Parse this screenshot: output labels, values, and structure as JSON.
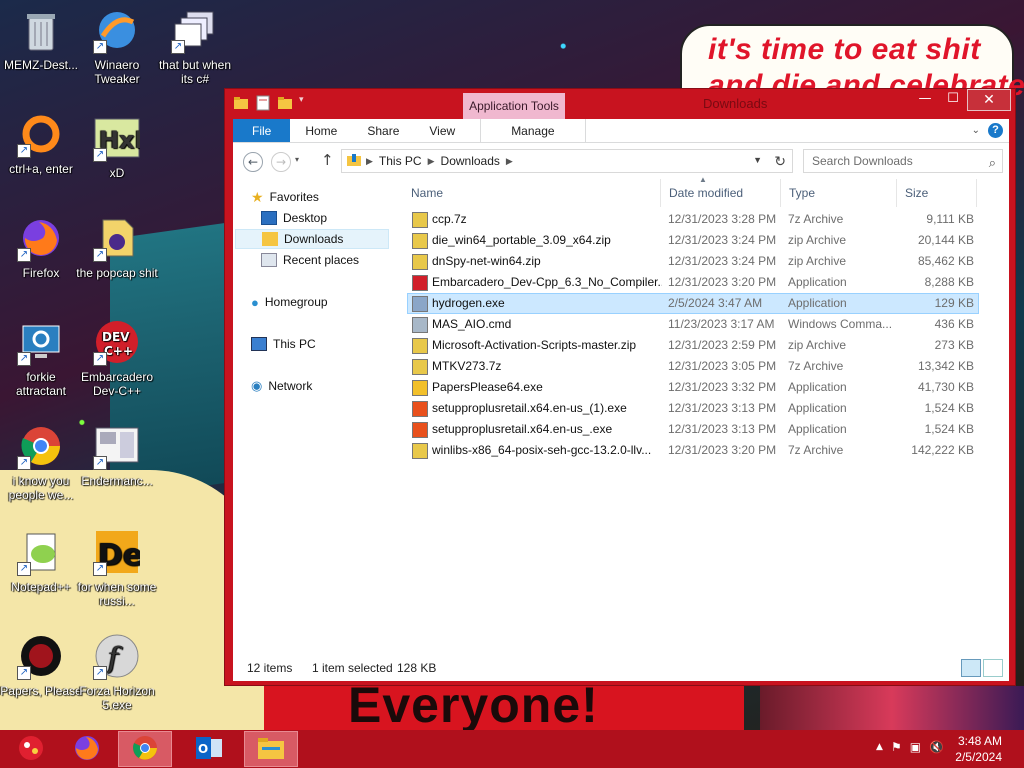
{
  "wallpaper": {
    "bubble_text": "it's time to eat shit and die and celebrate",
    "banner_text": "Everyone!"
  },
  "desktop": {
    "icons": [
      {
        "label": "MEMZ-Dest...",
        "icon": "recycle-bin-icon"
      },
      {
        "label": "Winaero Tweaker",
        "icon": "winaero-icon"
      },
      {
        "label": "that but when its c#",
        "icon": "windows-stack-icon"
      },
      {
        "label": "ctrl+a, enter",
        "icon": "orange-ring-icon"
      },
      {
        "label": "xD",
        "icon": "hxd-icon"
      },
      {
        "label": "Firefox",
        "icon": "firefox-icon"
      },
      {
        "label": "the popcap shit",
        "icon": "popcap-icon"
      },
      {
        "label": "forkie attractant",
        "icon": "gear-monitor-icon"
      },
      {
        "label": "Embarcadero Dev-C++",
        "icon": "devcpp-icon"
      },
      {
        "label": "i know you people we...",
        "icon": "chrome-icon"
      },
      {
        "label": "Endermanc...",
        "icon": "enderman-icon"
      },
      {
        "label": "Notepad++",
        "icon": "notepadpp-icon"
      },
      {
        "label": "for when some russi...",
        "icon": "de-icon"
      },
      {
        "label": "Papers, Please",
        "icon": "papers-please-icon"
      },
      {
        "label": "Forza Horizon 5.exe",
        "icon": "flash-icon"
      }
    ]
  },
  "window": {
    "title": "Downloads",
    "contextual_tab": "Application Tools",
    "ribbon_tabs": [
      "File",
      "Home",
      "Share",
      "View",
      "Manage"
    ],
    "breadcrumb": [
      "This PC",
      "Downloads"
    ],
    "search_placeholder": "Search Downloads",
    "nav": {
      "favorites": "Favorites",
      "desktop": "Desktop",
      "downloads": "Downloads",
      "recent": "Recent places",
      "homegroup": "Homegroup",
      "thispc": "This PC",
      "network": "Network"
    },
    "columns": [
      "Name",
      "Date modified",
      "Type",
      "Size"
    ],
    "files": [
      {
        "name": "ccp.7z",
        "date": "12/31/2023 3:28 PM",
        "type": "7z Archive",
        "size": "9,111 KB",
        "icon": "archive"
      },
      {
        "name": "die_win64_portable_3.09_x64.zip",
        "date": "12/31/2023 3:24 PM",
        "type": "zip Archive",
        "size": "20,144 KB",
        "icon": "archive"
      },
      {
        "name": "dnSpy-net-win64.zip",
        "date": "12/31/2023 3:24 PM",
        "type": "zip Archive",
        "size": "85,462 KB",
        "icon": "archive"
      },
      {
        "name": "Embarcadero_Dev-Cpp_6.3_No_Compiler...",
        "date": "12/31/2023 3:20 PM",
        "type": "Application",
        "size": "8,288 KB",
        "icon": "devcpp"
      },
      {
        "name": "hydrogen.exe",
        "date": "2/5/2024 3:47 AM",
        "type": "Application",
        "size": "129 KB",
        "icon": "exe"
      },
      {
        "name": "MAS_AIO.cmd",
        "date": "11/23/2023 3:17 AM",
        "type": "Windows Comma...",
        "size": "436 KB",
        "icon": "cmd"
      },
      {
        "name": "Microsoft-Activation-Scripts-master.zip",
        "date": "12/31/2023 2:59 PM",
        "type": "zip Archive",
        "size": "273 KB",
        "icon": "archive"
      },
      {
        "name": "MTKV273.7z",
        "date": "12/31/2023 3:05 PM",
        "type": "7z Archive",
        "size": "13,342 KB",
        "icon": "archive"
      },
      {
        "name": "PapersPlease64.exe",
        "date": "12/31/2023 3:32 PM",
        "type": "Application",
        "size": "41,730 KB",
        "icon": "papers"
      },
      {
        "name": "setupproplusretail.x64.en-us_(1).exe",
        "date": "12/31/2023 3:13 PM",
        "type": "Application",
        "size": "1,524 KB",
        "icon": "office"
      },
      {
        "name": "setupproplusretail.x64.en-us_.exe",
        "date": "12/31/2023 3:13 PM",
        "type": "Application",
        "size": "1,524 KB",
        "icon": "office"
      },
      {
        "name": "winlibs-x86_64-posix-seh-gcc-13.2.0-llv...",
        "date": "12/31/2023 3:20 PM",
        "type": "7z Archive",
        "size": "142,222 KB",
        "icon": "archive"
      }
    ],
    "selected_index": 4,
    "status": {
      "count": "12 items",
      "selection": "1 item selected",
      "selection_size": "128 KB"
    }
  },
  "taskbar": {
    "items": [
      "start-orb-icon",
      "firefox-icon",
      "chrome-icon",
      "outlook-icon",
      "file-explorer-icon"
    ],
    "clock_time": "3:48 AM",
    "clock_date": "2/5/2024"
  },
  "colors": {
    "window_frame": "#c8131f",
    "taskbar": "#b0101c",
    "file_tab": "#1979ca",
    "selection": "#cce8ff"
  }
}
